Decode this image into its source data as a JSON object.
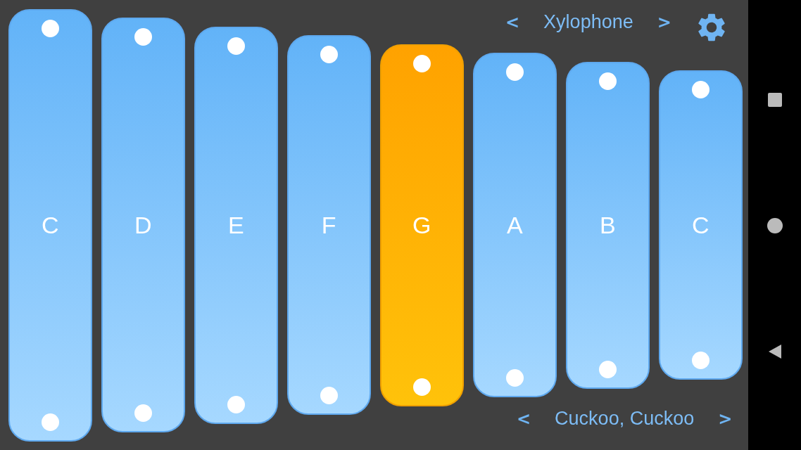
{
  "instrument": {
    "prev": "<",
    "label": "Xylophone",
    "next": ">"
  },
  "song": {
    "prev": "<",
    "label": "Cuckoo, Cuckoo",
    "next": ">"
  },
  "bars": [
    {
      "note": "C",
      "selected": false
    },
    {
      "note": "D",
      "selected": false
    },
    {
      "note": "E",
      "selected": false
    },
    {
      "note": "F",
      "selected": false
    },
    {
      "note": "G",
      "selected": true
    },
    {
      "note": "A",
      "selected": false
    },
    {
      "note": "B",
      "selected": false
    },
    {
      "note": "C",
      "selected": false
    }
  ]
}
